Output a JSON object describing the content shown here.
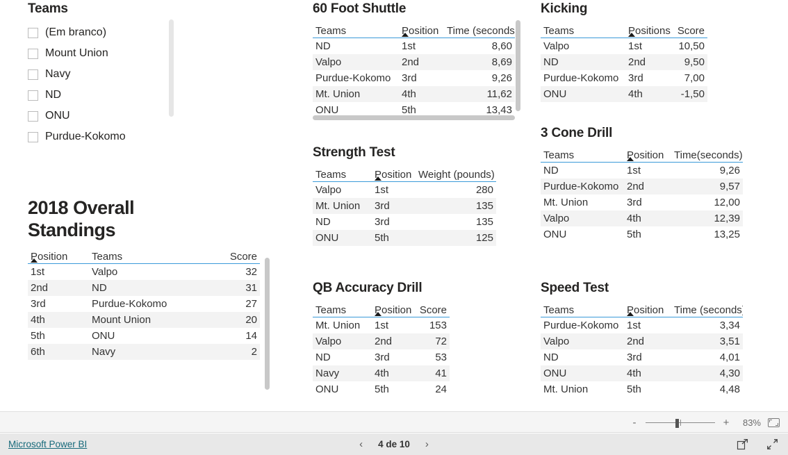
{
  "slicer": {
    "title": "Teams",
    "items": [
      {
        "label": "(Em branco)",
        "checked": false
      },
      {
        "label": "Mount Union",
        "checked": false
      },
      {
        "label": "Navy",
        "checked": false
      },
      {
        "label": "ND",
        "checked": false
      },
      {
        "label": "ONU",
        "checked": false
      },
      {
        "label": "Purdue-Kokomo",
        "checked": false
      }
    ]
  },
  "standings": {
    "title": "2018 Overall Standings",
    "columns": [
      "Position",
      "Teams",
      "Score"
    ],
    "sort_column": "Position",
    "rows": [
      [
        "1st",
        "Valpo",
        "32"
      ],
      [
        "2nd",
        "ND",
        "31"
      ],
      [
        "3rd",
        "Purdue-Kokomo",
        "27"
      ],
      [
        "4th",
        "Mount Union",
        "20"
      ],
      [
        "5th",
        "ONU",
        "14"
      ],
      [
        "6th",
        "Navy",
        "2"
      ]
    ]
  },
  "shuttle": {
    "title": "60 Foot Shuttle",
    "columns": [
      "Teams",
      "Position",
      "Time (seconds)"
    ],
    "sort_column": "Position",
    "rows": [
      [
        "ND",
        "1st",
        "8,60"
      ],
      [
        "Valpo",
        "2nd",
        "8,69"
      ],
      [
        "Purdue-Kokomo",
        "3rd",
        "9,26"
      ],
      [
        "Mt. Union",
        "4th",
        "11,62"
      ],
      [
        "ONU",
        "5th",
        "13,43"
      ]
    ]
  },
  "strength": {
    "title": "Strength Test",
    "columns": [
      "Teams",
      "Position",
      "Weight (pounds)"
    ],
    "sort_column": "Position",
    "rows": [
      [
        "Valpo",
        "1st",
        "280"
      ],
      [
        "Mt. Union",
        "3rd",
        "135"
      ],
      [
        "ND",
        "3rd",
        "135"
      ],
      [
        "ONU",
        "5th",
        "125"
      ]
    ]
  },
  "qb": {
    "title": "QB Accuracy Drill",
    "columns": [
      "Teams",
      "Position",
      "Score"
    ],
    "sort_column": "Position",
    "rows": [
      [
        "Mt. Union",
        "1st",
        "153"
      ],
      [
        "Valpo",
        "2nd",
        "72"
      ],
      [
        "ND",
        "3rd",
        "53"
      ],
      [
        "Navy",
        "4th",
        "41"
      ],
      [
        "ONU",
        "5th",
        "24"
      ]
    ]
  },
  "kicking": {
    "title": "Kicking",
    "columns": [
      "Teams",
      "Positions",
      "Score"
    ],
    "sort_column": "Positions",
    "rows": [
      [
        "Valpo",
        "1st",
        "10,50"
      ],
      [
        "ND",
        "2nd",
        "9,50"
      ],
      [
        "Purdue-Kokomo",
        "3rd",
        "7,00"
      ],
      [
        "ONU",
        "4th",
        "-1,50"
      ]
    ]
  },
  "cone": {
    "title": "3 Cone Drill",
    "columns": [
      "Teams",
      "Position",
      "Time(seconds)"
    ],
    "sort_column": "Position",
    "rows": [
      [
        "ND",
        "1st",
        "9,26"
      ],
      [
        "Purdue-Kokomo",
        "2nd",
        "9,57"
      ],
      [
        "Mt. Union",
        "3rd",
        "12,00"
      ],
      [
        "Valpo",
        "4th",
        "12,39"
      ],
      [
        "ONU",
        "5th",
        "13,25"
      ]
    ]
  },
  "speed": {
    "title": "Speed Test",
    "columns": [
      "Teams",
      "Position",
      "Time (seconds)"
    ],
    "sort_column": "Position",
    "rows": [
      [
        "Purdue-Kokomo",
        "1st",
        "3,34"
      ],
      [
        "Valpo",
        "2nd",
        "3,51"
      ],
      [
        "ND",
        "3rd",
        "4,01"
      ],
      [
        "ONU",
        "4th",
        "4,30"
      ],
      [
        "Mt. Union",
        "5th",
        "4,48"
      ]
    ]
  },
  "toolbar": {
    "zoom_out_label": "-",
    "zoom_in_label": "+",
    "zoom_percent": "83%",
    "fit_icon": "fit-to-page-icon"
  },
  "footer": {
    "brand": "Microsoft Power BI",
    "prev_label": "‹",
    "next_label": "›",
    "page_label": "4 de 10",
    "share_icon": "share-icon",
    "fullscreen_icon": "fullscreen-icon"
  }
}
